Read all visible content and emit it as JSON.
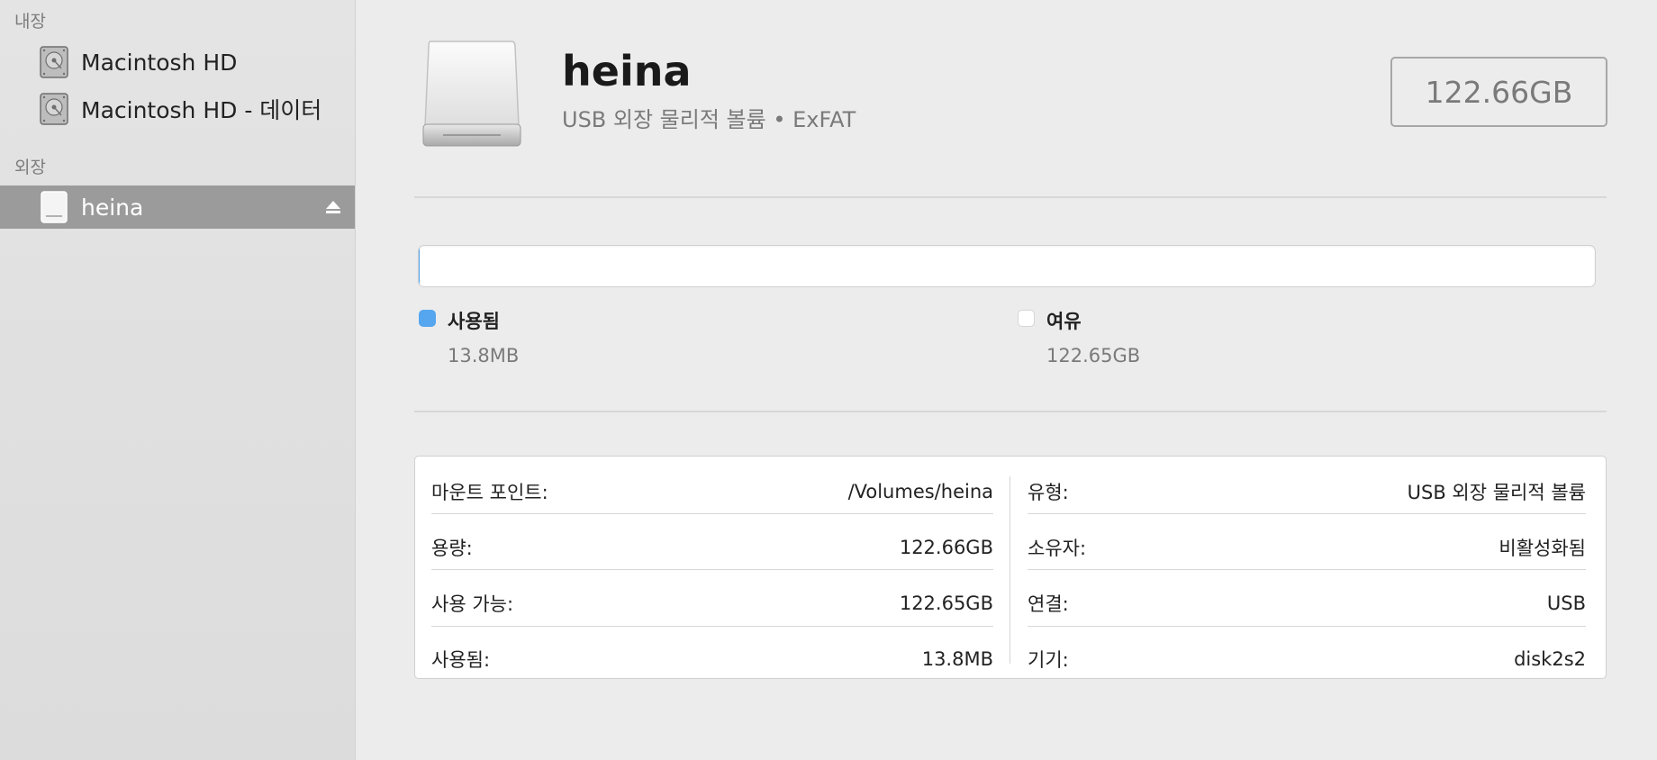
{
  "sidebar": {
    "internal_header": "내장",
    "external_header": "외장",
    "items": [
      {
        "label": "Macintosh HD",
        "icon": "internal-drive-icon"
      },
      {
        "label": "Macintosh HD - 데이터",
        "icon": "internal-drive-icon"
      },
      {
        "label": "heina",
        "icon": "external-drive-icon",
        "selected": true,
        "eject_icon": "eject-icon"
      }
    ]
  },
  "volume": {
    "name": "heina",
    "subtitle": "USB 외장 물리적 볼륨 • ExFAT",
    "capacity": "122.66GB",
    "icon": "external-drive-icon"
  },
  "usage": {
    "used_fraction": 0.0001,
    "used": {
      "label": "사용됨",
      "value": "13.8MB",
      "color": "#55a6ef"
    },
    "free": {
      "label": "여유",
      "value": "122.65GB",
      "color": "#ffffff"
    }
  },
  "info": {
    "left": [
      {
        "key": "마운트 포인트:",
        "value": "/Volumes/heina"
      },
      {
        "key": "용량:",
        "value": "122.66GB"
      },
      {
        "key": "사용 가능:",
        "value": "122.65GB"
      },
      {
        "key": "사용됨:",
        "value": "13.8MB"
      }
    ],
    "right": [
      {
        "key": "유형:",
        "value": "USB 외장 물리적 볼륨"
      },
      {
        "key": "소유자:",
        "value": "비활성화됨"
      },
      {
        "key": "연결:",
        "value": "USB"
      },
      {
        "key": "기기:",
        "value": "disk2s2"
      }
    ]
  }
}
